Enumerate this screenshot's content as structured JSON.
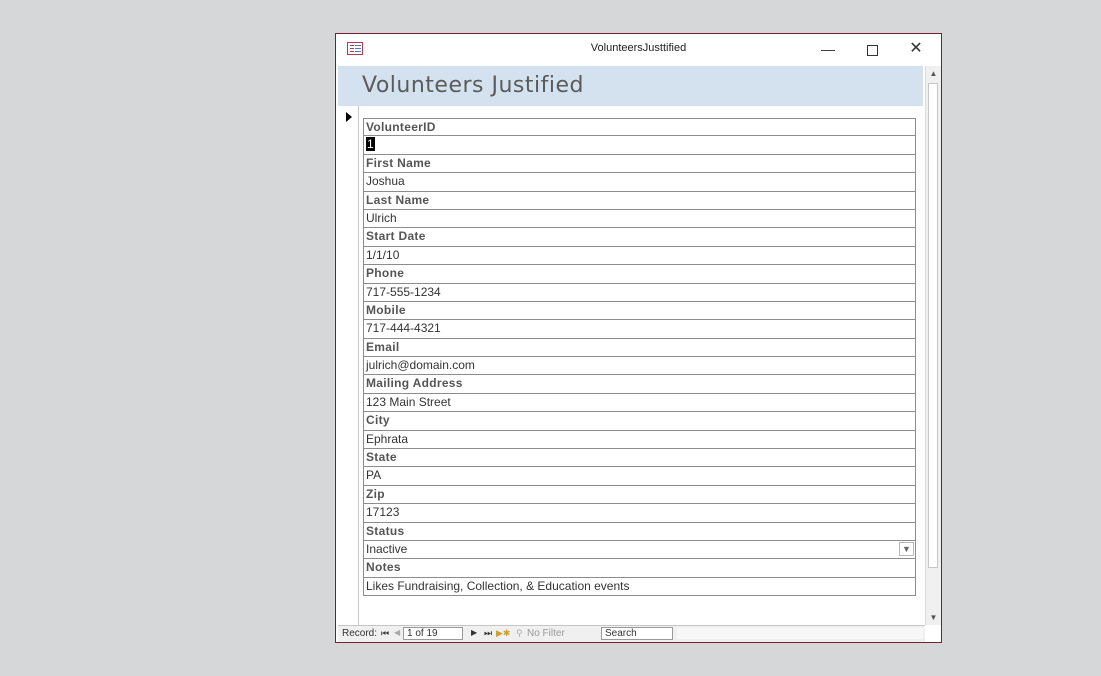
{
  "window": {
    "title": "VolunteersJusttified",
    "minimize": "—",
    "close": "✕"
  },
  "form": {
    "title": "Volunteers Justified"
  },
  "fields": [
    {
      "label": "VolunteerID",
      "value": "1"
    },
    {
      "label": "First Name",
      "value": "Joshua"
    },
    {
      "label": "Last Name",
      "value": "Ulrich"
    },
    {
      "label": "Start Date",
      "value": "1/1/10"
    },
    {
      "label": "Phone",
      "value": "717-555-1234"
    },
    {
      "label": "Mobile",
      "value": "717-444-4321"
    },
    {
      "label": "Email",
      "value": "julrich@domain.com"
    },
    {
      "label": "Mailing Address",
      "value": "123 Main Street"
    },
    {
      "label": "City",
      "value": "Ephrata"
    },
    {
      "label": "State",
      "value": "PA"
    },
    {
      "label": "Zip",
      "value": "17123"
    },
    {
      "label": "Status",
      "value": "Inactive"
    },
    {
      "label": "Notes",
      "value": "Likes Fundraising, Collection, & Education events"
    }
  ],
  "navigation": {
    "label": "Record:",
    "current": "1 of 19",
    "filter": "No Filter",
    "search": "Search"
  },
  "colors": {
    "window_border": "#7a1e2c",
    "header_band": "#d3e2ee",
    "background": "#d6d7d9"
  }
}
